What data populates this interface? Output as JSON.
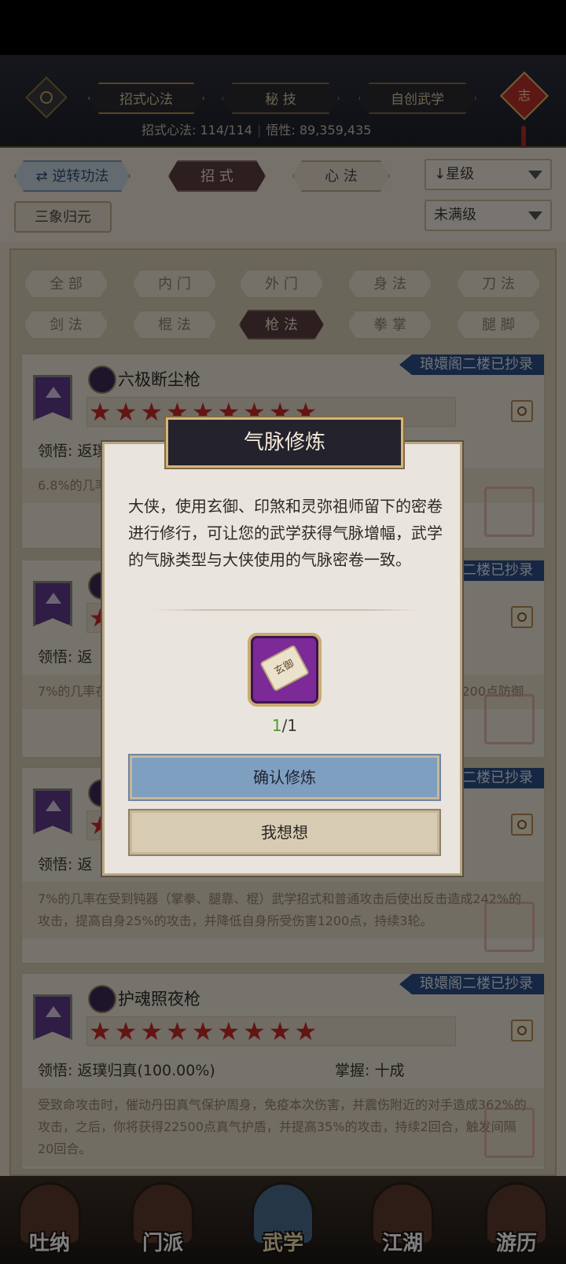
{
  "top_tabs": [
    "招式心法",
    "秘 技",
    "自创武学"
  ],
  "top_stats": {
    "count_label": "招式心法: 114/114",
    "insight_label": "悟性: 89,359,435"
  },
  "knot_char": "志",
  "filters": {
    "reverse_btn": "逆转功法",
    "tab_moves": "招 式",
    "tab_mind": "心 法",
    "sort_dropdown": "↓星级",
    "school": "三象归元",
    "level_dropdown": "未满级"
  },
  "categories": [
    "全 部",
    "内 门",
    "外 门",
    "身 法",
    "刀 法",
    "剑 法",
    "棍 法",
    "枪 法",
    "拳 掌",
    "腿 脚"
  ],
  "cards": [
    {
      "name": "六极断尘枪",
      "tag": "琅嬛阁二楼已抄录",
      "stars": "★★★★★★★★★",
      "comprehend": "领悟: 返璞归真(100.00%)",
      "desc": "6.8%的几率在受到攻击后使出反击，而自身攻击提高"
    },
    {
      "name": "",
      "tag": "琅嬛阁二楼已抄录",
      "stars": "★★★★★★★★★",
      "comprehend": "领悟: 返",
      "desc": "7%的几率在受到攻击后使出反击，反击对手造成2000%的攻击，提高自身7200点防御"
    },
    {
      "name": "",
      "tag": "琅嬛阁二楼已抄录",
      "stars": "★★★★★★★★★",
      "comprehend": "领悟: 返",
      "desc": "7%的几率在受到钝器（掌拳、腿靠、棍）武学招式和普通攻击后使出反击造成242%的攻击，提高自身25%的攻击，并降低自身所受伤害1200点，持续3轮。"
    },
    {
      "name": "护魂照夜枪",
      "tag": "琅嬛阁二楼已抄录",
      "stars": "★★★★★★★★★",
      "comprehend": "领悟: 返璞归真(100.00%)",
      "mastery": "掌握: 十成",
      "desc": "受致命攻击时，催动丹田真气保护周身，免疫本次伤害，并震伤附近的对手造成362%的攻击，之后，你将获得22500点真气护盾，并提高35%的攻击，持续2回合，触发间隔20回合。"
    }
  ],
  "nav": [
    "吐纳",
    "门派",
    "武学",
    "江湖",
    "游历"
  ],
  "dialog": {
    "title": "气脉修炼",
    "text": "大侠，使用玄御、印煞和灵弥祖师留下的密卷进行修行，可让您的武学获得气脉增幅，武学的气脉类型与大侠使用的气脉密卷一致。",
    "item_label": "玄御",
    "count_have": "1",
    "count_need": "/1",
    "confirm": "确认修炼",
    "cancel": "我想想"
  }
}
